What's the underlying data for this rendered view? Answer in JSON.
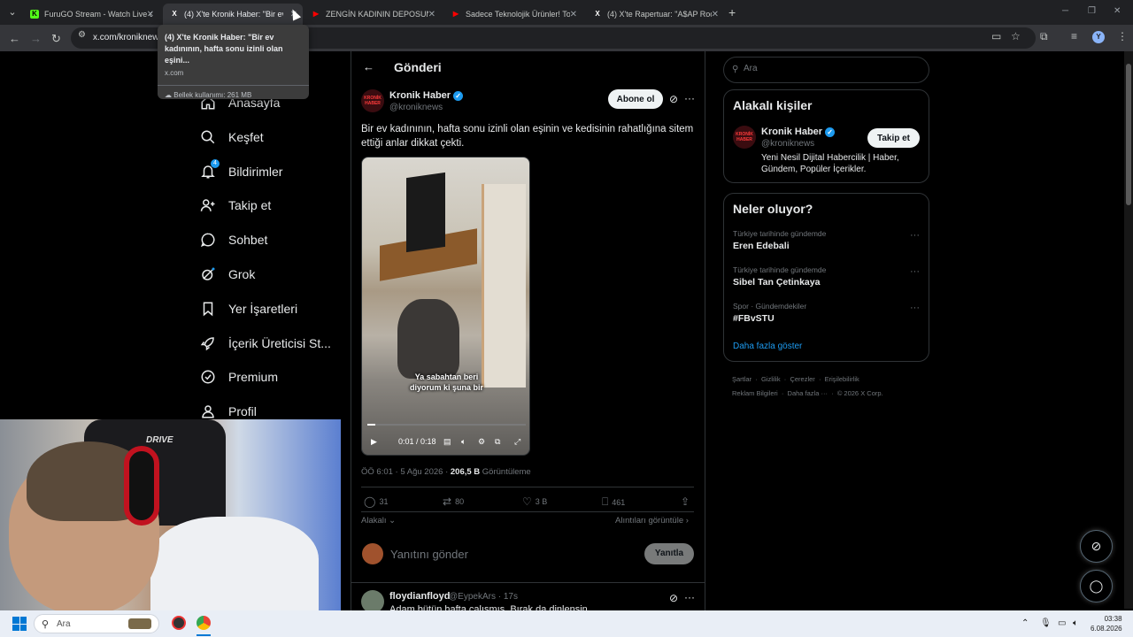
{
  "browser": {
    "tabs": [
      {
        "title": "FuruGO Stream - Watch Live or",
        "favicon": "K",
        "color": "#53fc18"
      },
      {
        "title": "(4) X'te Kronik Haber: \"Bir ev ka",
        "favicon": "X",
        "color": "#ffffff"
      },
      {
        "title": "ZENGİN KADININ DEPOSUNU",
        "favicon": "▶",
        "color": "#ff0000"
      },
      {
        "title": "Sadece Teknolojik Ürünler! Topl",
        "favicon": "▶",
        "color": "#ff0000"
      },
      {
        "title": "(4) X'te Rapertuar: \"A$AP Rocky",
        "favicon": "X",
        "color": "#ffffff"
      }
    ],
    "url": "x.com/kroniknews",
    "tooltip": {
      "title": "(4) X'te Kronik Haber: \"Bir ev kadınının, hafta sonu izinli olan eşini...",
      "domain": "x.com",
      "memory": "Bellek kullanımı: 261 MB"
    }
  },
  "sidebar": {
    "items": [
      {
        "label": "Anasayfa",
        "icon": "home-icon"
      },
      {
        "label": "Keşfet",
        "icon": "search-icon"
      },
      {
        "label": "Bildirimler",
        "icon": "bell-icon",
        "badge": "4"
      },
      {
        "label": "Takip et",
        "icon": "follow-icon"
      },
      {
        "label": "Sohbet",
        "icon": "chat-icon"
      },
      {
        "label": "Grok",
        "icon": "grok-icon"
      },
      {
        "label": "Yer İşaretleri",
        "icon": "bookmark-icon"
      },
      {
        "label": "İçerik Üreticisi St...",
        "icon": "rocket-icon"
      },
      {
        "label": "Premium",
        "icon": "verified-icon"
      },
      {
        "label": "Profil",
        "icon": "profile-icon"
      }
    ]
  },
  "post": {
    "header": "Gönderi",
    "author_name": "Kronik Haber",
    "author_handle": "@kroniknews",
    "avatar_text": "KRONİK HABER",
    "subscribe_label": "Abone ol",
    "text": "Bir ev kadınının, hafta sonu izinli olan eşinin ve kedisinin rahatlığına sitem ettiği anlar dikkat çekti.",
    "video": {
      "subtitle_line1": "Ya sabahtan beri",
      "subtitle_line2": "diyorum ki şuna bir",
      "time": "0:01 / 0:18",
      "progress": 0.05
    },
    "meta_time": "ÖÖ 6:01 · 5 Ağu 2026 · ",
    "views": "206,5 B",
    "views_label": " Görüntüleme",
    "actions": {
      "replies": "31",
      "reposts": "80",
      "likes": "3 B",
      "bookmarks": "461"
    },
    "sort_label": "Alakalı",
    "quotes_label": "Alıntıları görüntüle",
    "reply_placeholder": "Yanıtını gönder",
    "reply_button": "Yanıtla",
    "next_reply": {
      "name": "floydianfloyd",
      "handle": "@EypekArs · 17s",
      "text": "Adam bütün hafta çalışmış. Bırak da dinlensin"
    }
  },
  "right": {
    "search_placeholder": "Ara",
    "people_title": "Alakalı kişiler",
    "person": {
      "name": "Kronik Haber",
      "handle": "@kroniknews",
      "follow_label": "Takip et",
      "bio": "Yeni Nesil Dijital Habercilik | Haber, Gündem, Popüler İçerikler."
    },
    "trends_title": "Neler oluyor?",
    "trends": [
      {
        "category": "Türkiye tarihinde gündemde",
        "name": "Eren Edebali"
      },
      {
        "category": "Türkiye tarihinde gündemde",
        "name": "Sibel Tan Çetinkaya"
      },
      {
        "category": "Spor · Gündemdekiler",
        "name": "#FBvSTU"
      }
    ],
    "show_more": "Daha fazla göster",
    "footer_row1": [
      "Şartlar",
      "Gizlilik",
      "Çerezler",
      "Erişilebilirlik"
    ],
    "footer_row2": [
      "Reklam Bilgileri",
      "Daha fazla ···",
      "© 2026 X Corp."
    ]
  },
  "webcam": {
    "chair_text": "DRIVE"
  },
  "taskbar": {
    "search_label": "Ara",
    "time": "03:38",
    "date": "6.08.2026"
  },
  "colors": {
    "accent": "#1d9bf0",
    "background": "#000000",
    "border": "#2f3336"
  }
}
